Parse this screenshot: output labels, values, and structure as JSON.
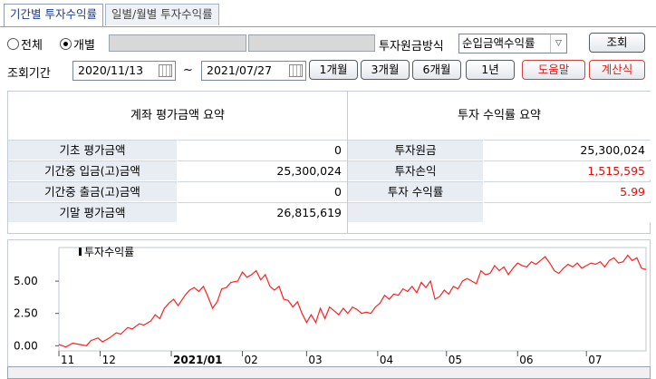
{
  "tabs": [
    {
      "label": "기간별 투자수익률",
      "active": true
    },
    {
      "label": "일별/월별 투자수익률",
      "active": false
    }
  ],
  "filter": {
    "radio_all": "전체",
    "radio_individual": "개별",
    "selected": "개별",
    "method_label": "투자원금방식",
    "method_value": "순입금액수익률",
    "search_button": "조회",
    "period_label": "조회기간",
    "start_date": "2020/11/13",
    "tilde": "~",
    "end_date": "2021/07/27",
    "btn_1m": "1개월",
    "btn_3m": "3개월",
    "btn_6m": "6개월",
    "btn_1y": "1년",
    "help_button": "도움말",
    "calc_button": "계산식"
  },
  "summary": {
    "left_title": "계좌 평가금액 요약",
    "right_title": "투자 수익률 요약",
    "left_rows": [
      {
        "label": "기초 평가금액",
        "value": "0"
      },
      {
        "label": "기간중 입금(고)금액",
        "value": "25,300,024"
      },
      {
        "label": "기간중 출금(고)금액",
        "value": "0"
      },
      {
        "label": "기말 평가금액",
        "value": "26,815,619"
      }
    ],
    "right_rows": [
      {
        "label": "투자원금",
        "value": "25,300,024",
        "red": false
      },
      {
        "label": "투자손익",
        "value": "1,515,595",
        "red": true
      },
      {
        "label": "투자 수익률",
        "value": "5.99",
        "red": true
      },
      {
        "label": "",
        "value": "",
        "red": false
      }
    ]
  },
  "chart_data": {
    "type": "line",
    "legend": "투자수익률",
    "line_color": "#ff2020",
    "y_ticks": [
      "5.00",
      "2.50",
      "0.00"
    ],
    "y_tick_values": [
      5,
      2.5,
      0
    ],
    "ylim": [
      -0.4,
      7.6
    ],
    "x_ticks": [
      {
        "label": "11",
        "pos": 0,
        "bold": false
      },
      {
        "label": "12",
        "pos": 18,
        "bold": false
      },
      {
        "label": "2021/01",
        "pos": 49,
        "bold": true
      },
      {
        "label": "02",
        "pos": 80,
        "bold": false
      },
      {
        "label": "03",
        "pos": 108,
        "bold": false
      },
      {
        "label": "04",
        "pos": 139,
        "bold": false
      },
      {
        "label": "05",
        "pos": 169,
        "bold": false
      },
      {
        "label": "06",
        "pos": 200,
        "bold": false
      },
      {
        "label": "07",
        "pos": 230,
        "bold": false
      }
    ],
    "xlim": [
      0,
      256
    ],
    "values": [
      [
        0,
        0.1
      ],
      [
        3,
        -0.1
      ],
      [
        6,
        0.2
      ],
      [
        9,
        0.1
      ],
      [
        12,
        0.0
      ],
      [
        14,
        0.4
      ],
      [
        17,
        0.6
      ],
      [
        19,
        0.3
      ],
      [
        22,
        0.6
      ],
      [
        25,
        1.0
      ],
      [
        27,
        0.9
      ],
      [
        30,
        1.4
      ],
      [
        32,
        1.3
      ],
      [
        35,
        1.7
      ],
      [
        37,
        1.6
      ],
      [
        40,
        1.9
      ],
      [
        42,
        2.4
      ],
      [
        44,
        2.1
      ],
      [
        46,
        2.9
      ],
      [
        48,
        3.3
      ],
      [
        50,
        3.6
      ],
      [
        52,
        3.1
      ],
      [
        55,
        3.9
      ],
      [
        57,
        4.3
      ],
      [
        59,
        4.5
      ],
      [
        61,
        4.2
      ],
      [
        63,
        4.6
      ],
      [
        65,
        3.8
      ],
      [
        67,
        2.9
      ],
      [
        69,
        3.4
      ],
      [
        71,
        4.4
      ],
      [
        73,
        4.5
      ],
      [
        75,
        4.9
      ],
      [
        78,
        5.0
      ],
      [
        80,
        5.7
      ],
      [
        82,
        5.3
      ],
      [
        84,
        5.5
      ],
      [
        86,
        5.8
      ],
      [
        88,
        5.1
      ],
      [
        90,
        5.5
      ],
      [
        92,
        4.6
      ],
      [
        94,
        4.3
      ],
      [
        96,
        4.6
      ],
      [
        98,
        3.6
      ],
      [
        100,
        3.5
      ],
      [
        102,
        3.0
      ],
      [
        104,
        3.4
      ],
      [
        106,
        2.5
      ],
      [
        108,
        1.8
      ],
      [
        110,
        2.4
      ],
      [
        112,
        1.8
      ],
      [
        114,
        2.9
      ],
      [
        116,
        2.1
      ],
      [
        118,
        3.0
      ],
      [
        120,
        2.7
      ],
      [
        122,
        2.4
      ],
      [
        124,
        2.9
      ],
      [
        126,
        2.5
      ],
      [
        128,
        3.0
      ],
      [
        130,
        2.8
      ],
      [
        132,
        2.5
      ],
      [
        134,
        2.6
      ],
      [
        136,
        2.5
      ],
      [
        138,
        3.0
      ],
      [
        140,
        3.3
      ],
      [
        142,
        3.9
      ],
      [
        144,
        3.6
      ],
      [
        146,
        4.0
      ],
      [
        148,
        3.9
      ],
      [
        150,
        4.4
      ],
      [
        152,
        4.2
      ],
      [
        154,
        4.6
      ],
      [
        156,
        4.1
      ],
      [
        158,
        4.9
      ],
      [
        160,
        4.5
      ],
      [
        162,
        5.0
      ],
      [
        164,
        3.6
      ],
      [
        166,
        3.8
      ],
      [
        168,
        4.3
      ],
      [
        170,
        4.0
      ],
      [
        172,
        4.6
      ],
      [
        174,
        4.4
      ],
      [
        176,
        5.0
      ],
      [
        178,
        5.2
      ],
      [
        180,
        5.0
      ],
      [
        182,
        4.8
      ],
      [
        184,
        5.8
      ],
      [
        186,
        5.5
      ],
      [
        188,
        5.6
      ],
      [
        190,
        6.2
      ],
      [
        192,
        5.8
      ],
      [
        194,
        6.1
      ],
      [
        196,
        5.5
      ],
      [
        198,
        6.0
      ],
      [
        200,
        6.4
      ],
      [
        202,
        6.2
      ],
      [
        204,
        6.1
      ],
      [
        206,
        6.5
      ],
      [
        208,
        6.3
      ],
      [
        210,
        6.6
      ],
      [
        212,
        6.9
      ],
      [
        214,
        6.4
      ],
      [
        216,
        5.8
      ],
      [
        218,
        5.6
      ],
      [
        220,
        6.0
      ],
      [
        222,
        6.3
      ],
      [
        224,
        6.1
      ],
      [
        226,
        6.4
      ],
      [
        228,
        6.0
      ],
      [
        230,
        6.2
      ],
      [
        232,
        6.4
      ],
      [
        234,
        6.3
      ],
      [
        236,
        6.5
      ],
      [
        238,
        6.1
      ],
      [
        240,
        6.6
      ],
      [
        242,
        6.8
      ],
      [
        244,
        6.4
      ],
      [
        246,
        6.5
      ],
      [
        248,
        7.0
      ],
      [
        250,
        6.6
      ],
      [
        252,
        6.8
      ],
      [
        254,
        6.0
      ],
      [
        256,
        5.9
      ]
    ]
  }
}
